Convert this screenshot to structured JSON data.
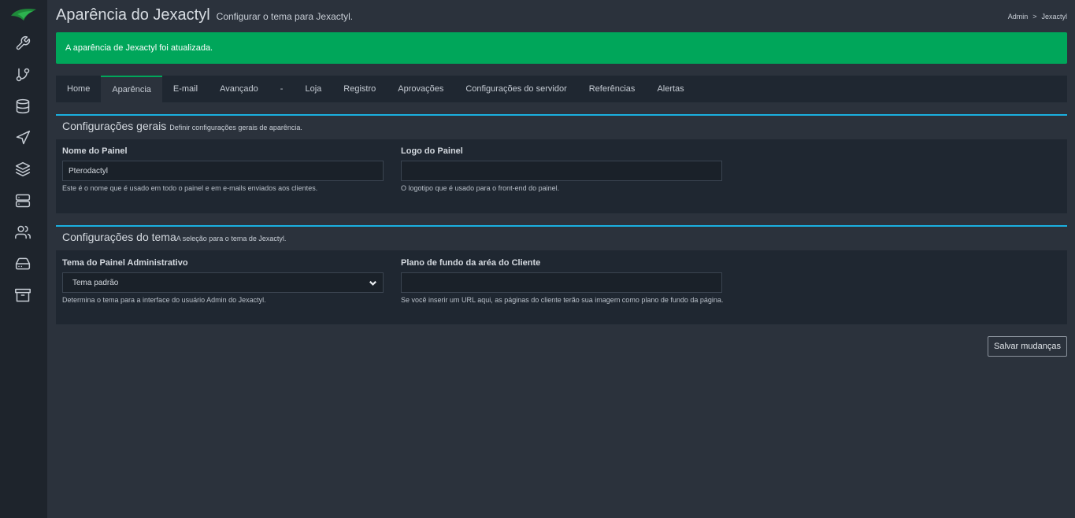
{
  "colors": {
    "accent": "#00a65a",
    "box_border": "#1ab0e0",
    "sidebar_bg": "#1e242c",
    "page_bg": "#2b323c"
  },
  "sidebar": {
    "icons": [
      "wrench-icon",
      "git-branch-icon",
      "database-icon",
      "send-icon",
      "layers-icon",
      "server-icon",
      "users-icon",
      "hard-drive-icon",
      "archive-icon"
    ]
  },
  "header": {
    "title": "Aparência do Jexactyl",
    "subtitle": "Configurar o tema para Jexactyl."
  },
  "breadcrumb": {
    "root": "Admin",
    "separator": ">",
    "current": "Jexactyl"
  },
  "alert": {
    "message": "A aparência de Jexactyl foi atualizada."
  },
  "tabs": [
    {
      "label": "Home",
      "active": false
    },
    {
      "label": "Aparência",
      "active": true
    },
    {
      "label": "E-mail",
      "active": false
    },
    {
      "label": "Avançado",
      "active": false
    },
    {
      "label": "-",
      "active": false
    },
    {
      "label": "Loja",
      "active": false
    },
    {
      "label": "Registro",
      "active": false
    },
    {
      "label": "Aprovações",
      "active": false
    },
    {
      "label": "Configurações do servidor",
      "active": false
    },
    {
      "label": "Referências",
      "active": false
    },
    {
      "label": "Alertas",
      "active": false
    }
  ],
  "general": {
    "title": "Configurações gerais",
    "subtitle": "Definir configurações gerais de aparência.",
    "panel_name": {
      "label": "Nome do Painel",
      "value": "Pterodactyl",
      "help": "Este é o nome que é usado em todo o painel e em e-mails enviados aos clientes."
    },
    "panel_logo": {
      "label": "Logo do Painel",
      "value": "",
      "help": "O logotipo que é usado para o front-end do painel."
    }
  },
  "theme": {
    "title": "Configurações do tema",
    "subtitle": "A seleção para o tema de Jexactyl.",
    "admin_theme": {
      "label": "Tema do Painel Administrativo",
      "selected": "Tema padrão",
      "help": "Determina o tema para a interface do usuário Admin do Jexactyl."
    },
    "client_background": {
      "label": "Plano de fundo da aréa do Cliente",
      "value": "",
      "help": "Se você inserir um URL aqui, as páginas do cliente terão sua imagem como plano de fundo da página."
    }
  },
  "actions": {
    "save_label": "Salvar mudanças"
  }
}
